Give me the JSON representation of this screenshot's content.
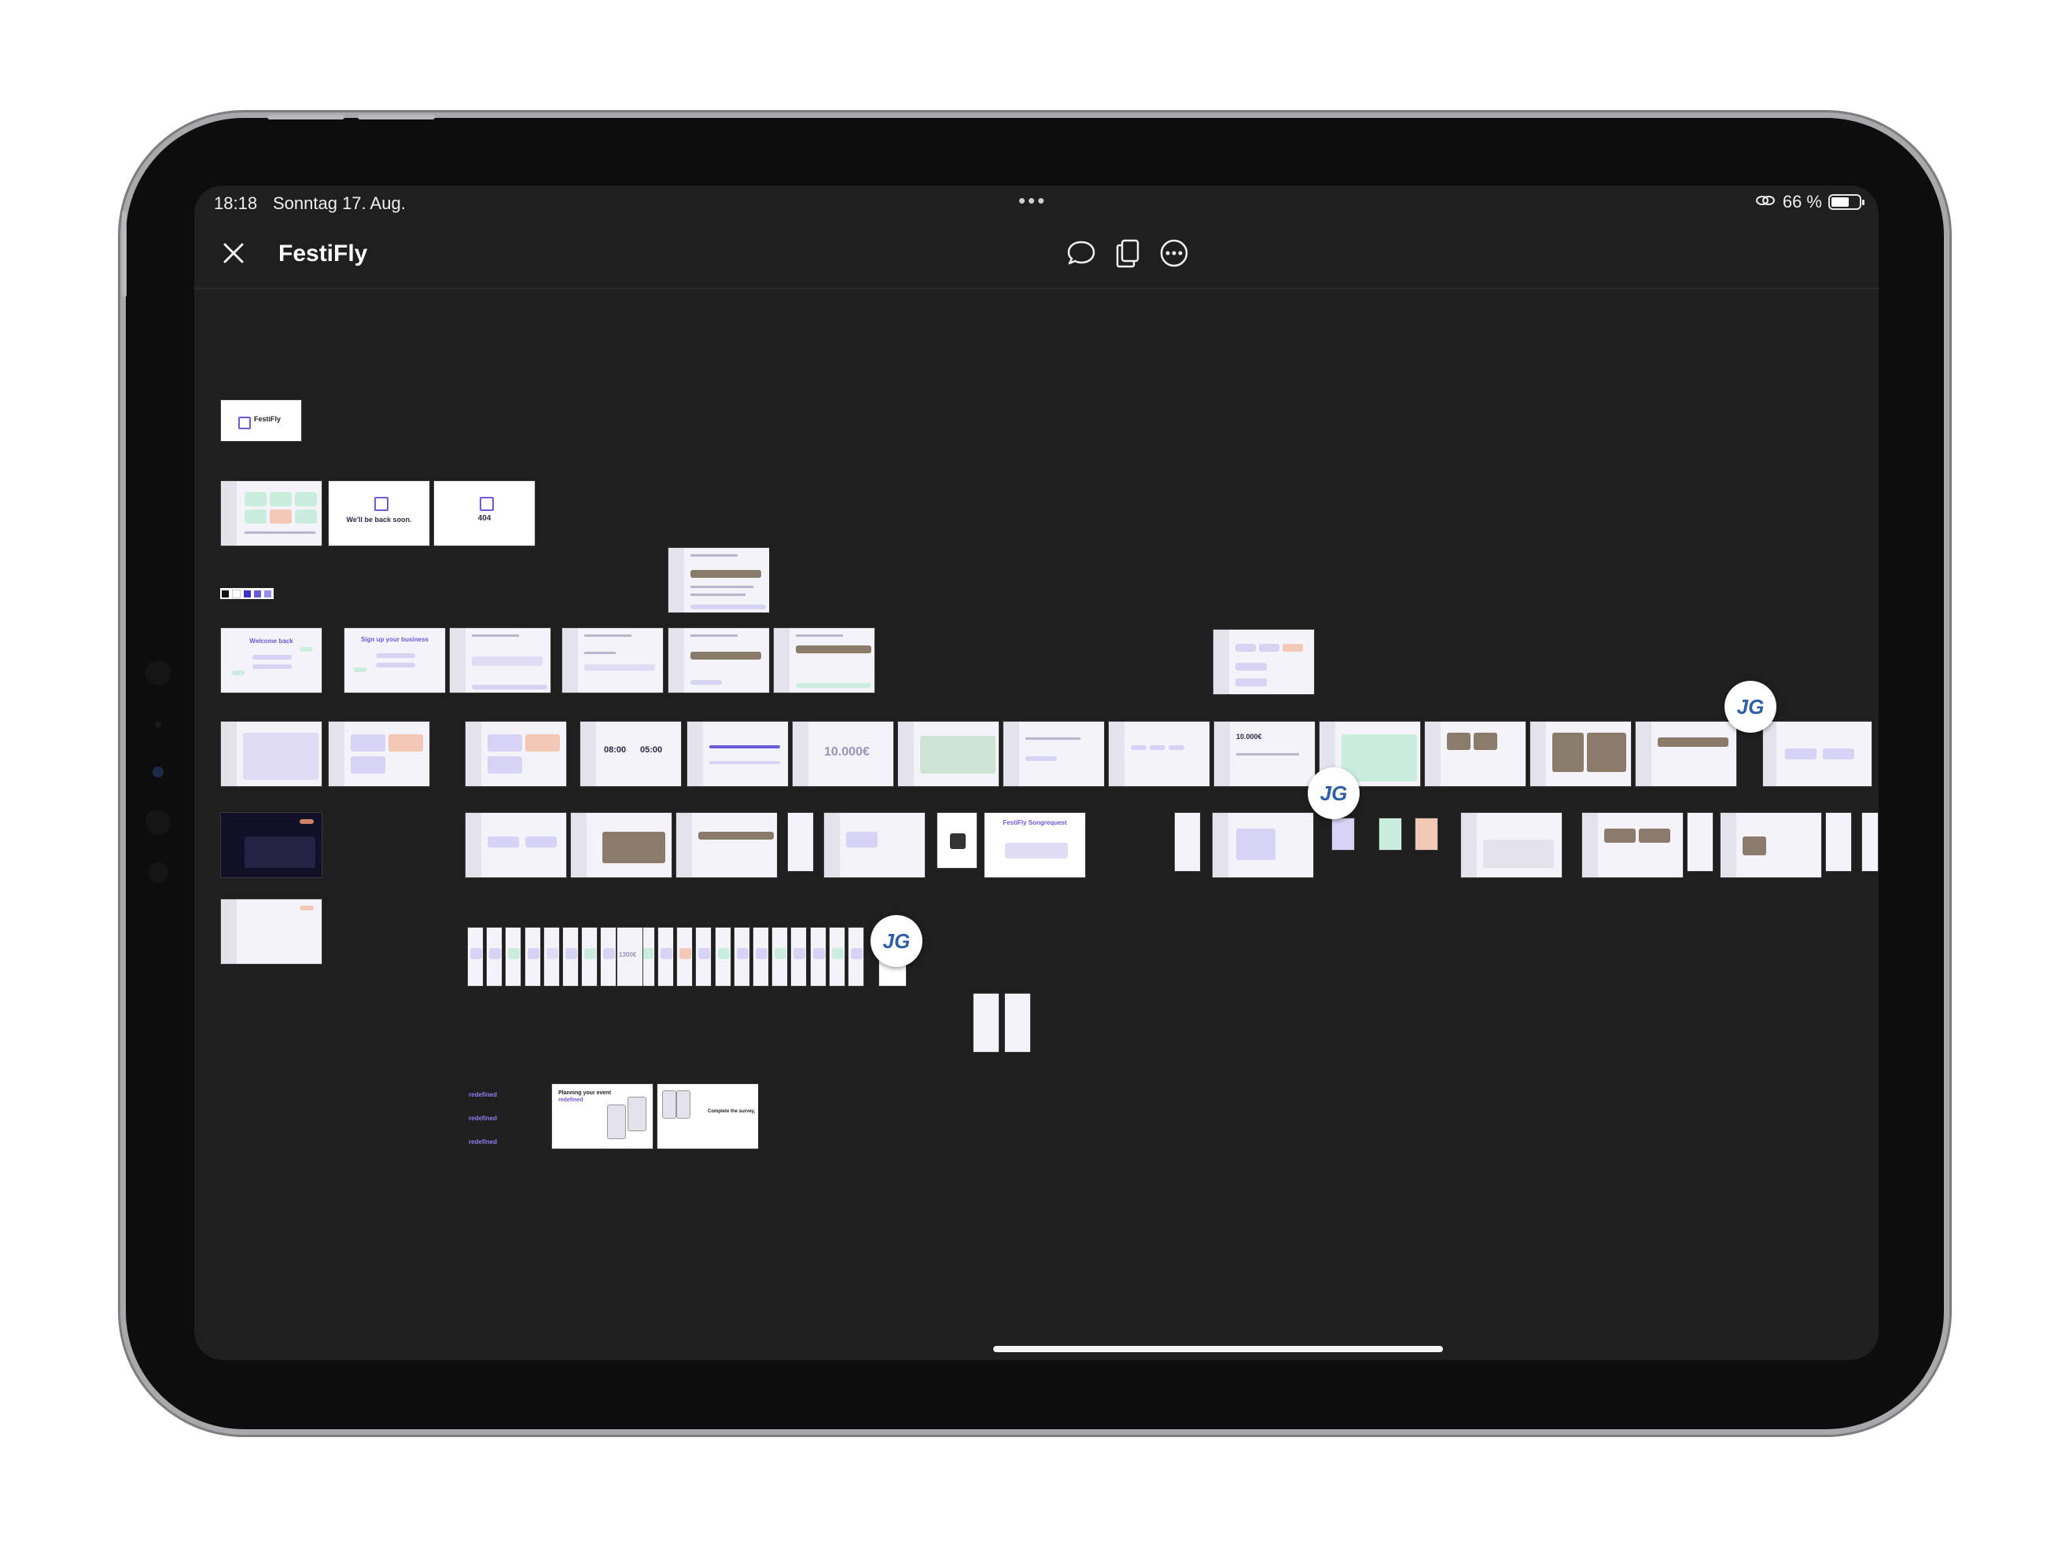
{
  "status_bar": {
    "time": "18:18",
    "date": "Sonntag 17. Aug.",
    "multitask_dots": "•••",
    "battery_percent": "66 %",
    "battery_level": 0.66
  },
  "toolbar": {
    "title": "FestiFly",
    "close_icon": "close-icon",
    "comment_icon": "comment-icon",
    "copy_icon": "copy-pages-icon",
    "more_icon": "more-options-icon"
  },
  "canvas": {
    "logo_frame_text": "FestiFly",
    "maintenance_text": "We'll be back soon.",
    "error_code": "404",
    "login_title": "Welcome back",
    "signup_title": "Sign up your business",
    "budget_value": "10.000€",
    "budget_value_2": "10.000€",
    "time_start": "08:00",
    "time_end": "05:00",
    "songrequest_title": "FestiFly Songrequest",
    "small_budget": "1300€",
    "promo_redefined": "redefined",
    "promo_planning_title": "Planning your event",
    "promo_planning_sub": "redefined",
    "promo_survey_title": "Complete the survey,",
    "avatar_initials": "JG"
  },
  "colors": {
    "accent": "#6b5bd6",
    "frame_bg": "#f4f3fa",
    "canvas_bg": "#1f1f1f",
    "peach": "#f3c9b6",
    "mint": "#c9eedd",
    "lavender": "#d7d3f5"
  }
}
